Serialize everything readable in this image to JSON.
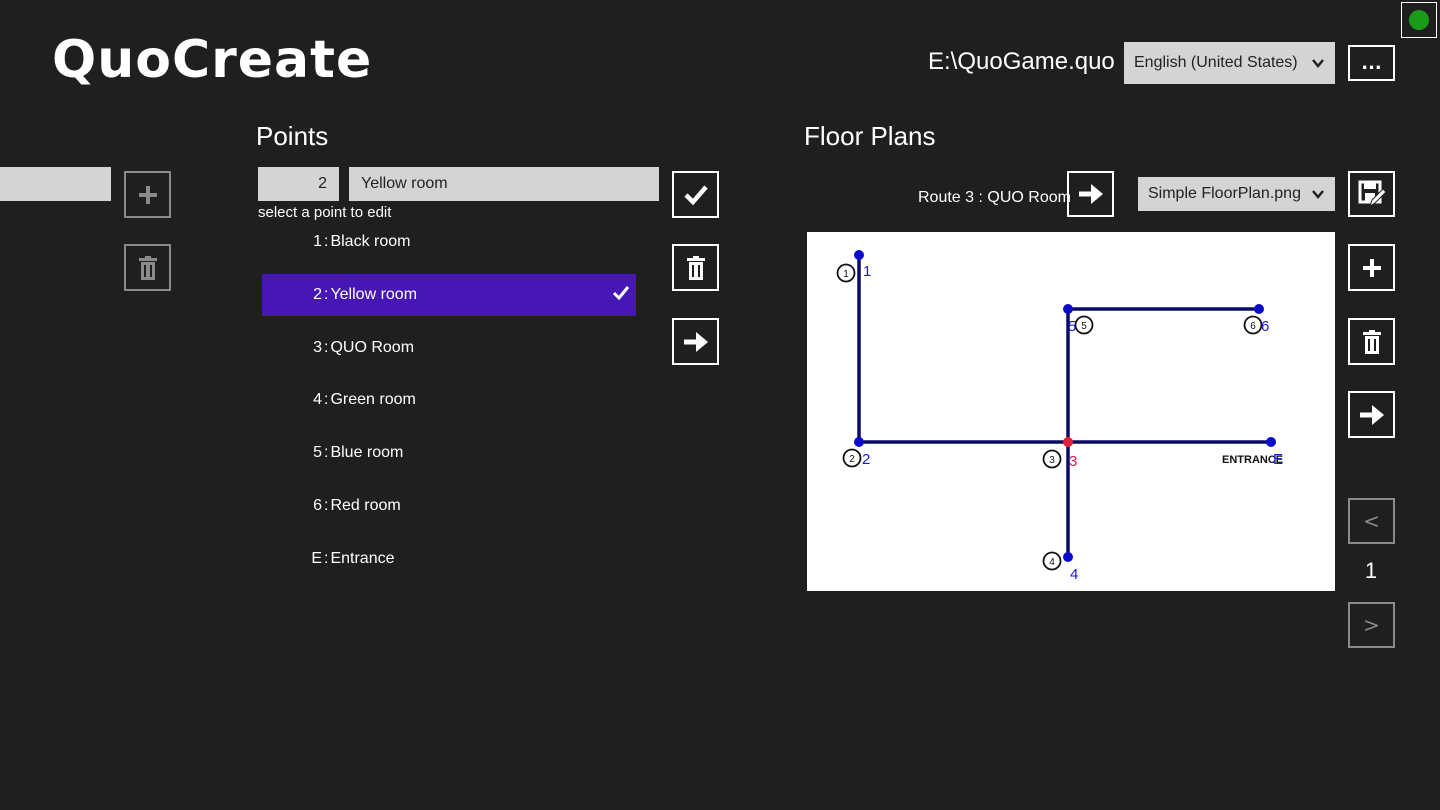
{
  "app": {
    "title": "QuoCreate",
    "file_path": "E:\\QuoGame.quo",
    "language": "English (United States)",
    "more_label": "..."
  },
  "points": {
    "title": "Points",
    "number_value": "2",
    "name_value": "Yellow room",
    "hint": "select a point to edit",
    "items": [
      {
        "num": "1",
        "sep": ":",
        "label": "Black room"
      },
      {
        "num": "2",
        "sep": ":",
        "label": "Yellow room"
      },
      {
        "num": "3",
        "sep": ":",
        "label": "QUO Room"
      },
      {
        "num": "4",
        "sep": ":",
        "label": "Green room"
      },
      {
        "num": "5",
        "sep": ":",
        "label": "Blue room"
      },
      {
        "num": "6",
        "sep": ":",
        "label": "Red room"
      },
      {
        "num": "E",
        "sep": ":",
        "label": "Entrance"
      }
    ],
    "selected_index": 1
  },
  "floor_plans": {
    "title": "Floor Plans",
    "route_label": "Route 3 : QUO Room",
    "selected_plan": "Simple FloorPlan.png",
    "page": "1",
    "prev_label": "<",
    "next_label": ">",
    "entrance_text": "ENTRANCE",
    "circle_labels": [
      "1",
      "2",
      "3",
      "4",
      "5",
      "6"
    ],
    "marker_labels": [
      "1",
      "2",
      "3",
      "4",
      "5",
      "6",
      "E"
    ]
  },
  "colors": {
    "accent": "#4617b4",
    "route": "#0a0acc",
    "current_point": "#e0203c",
    "status": "#1a9c1a"
  },
  "icons": {
    "add": "plus-icon",
    "delete": "trash-icon",
    "confirm": "check-icon",
    "go": "arrow-right-icon",
    "edit_plan": "edit-image-icon"
  }
}
